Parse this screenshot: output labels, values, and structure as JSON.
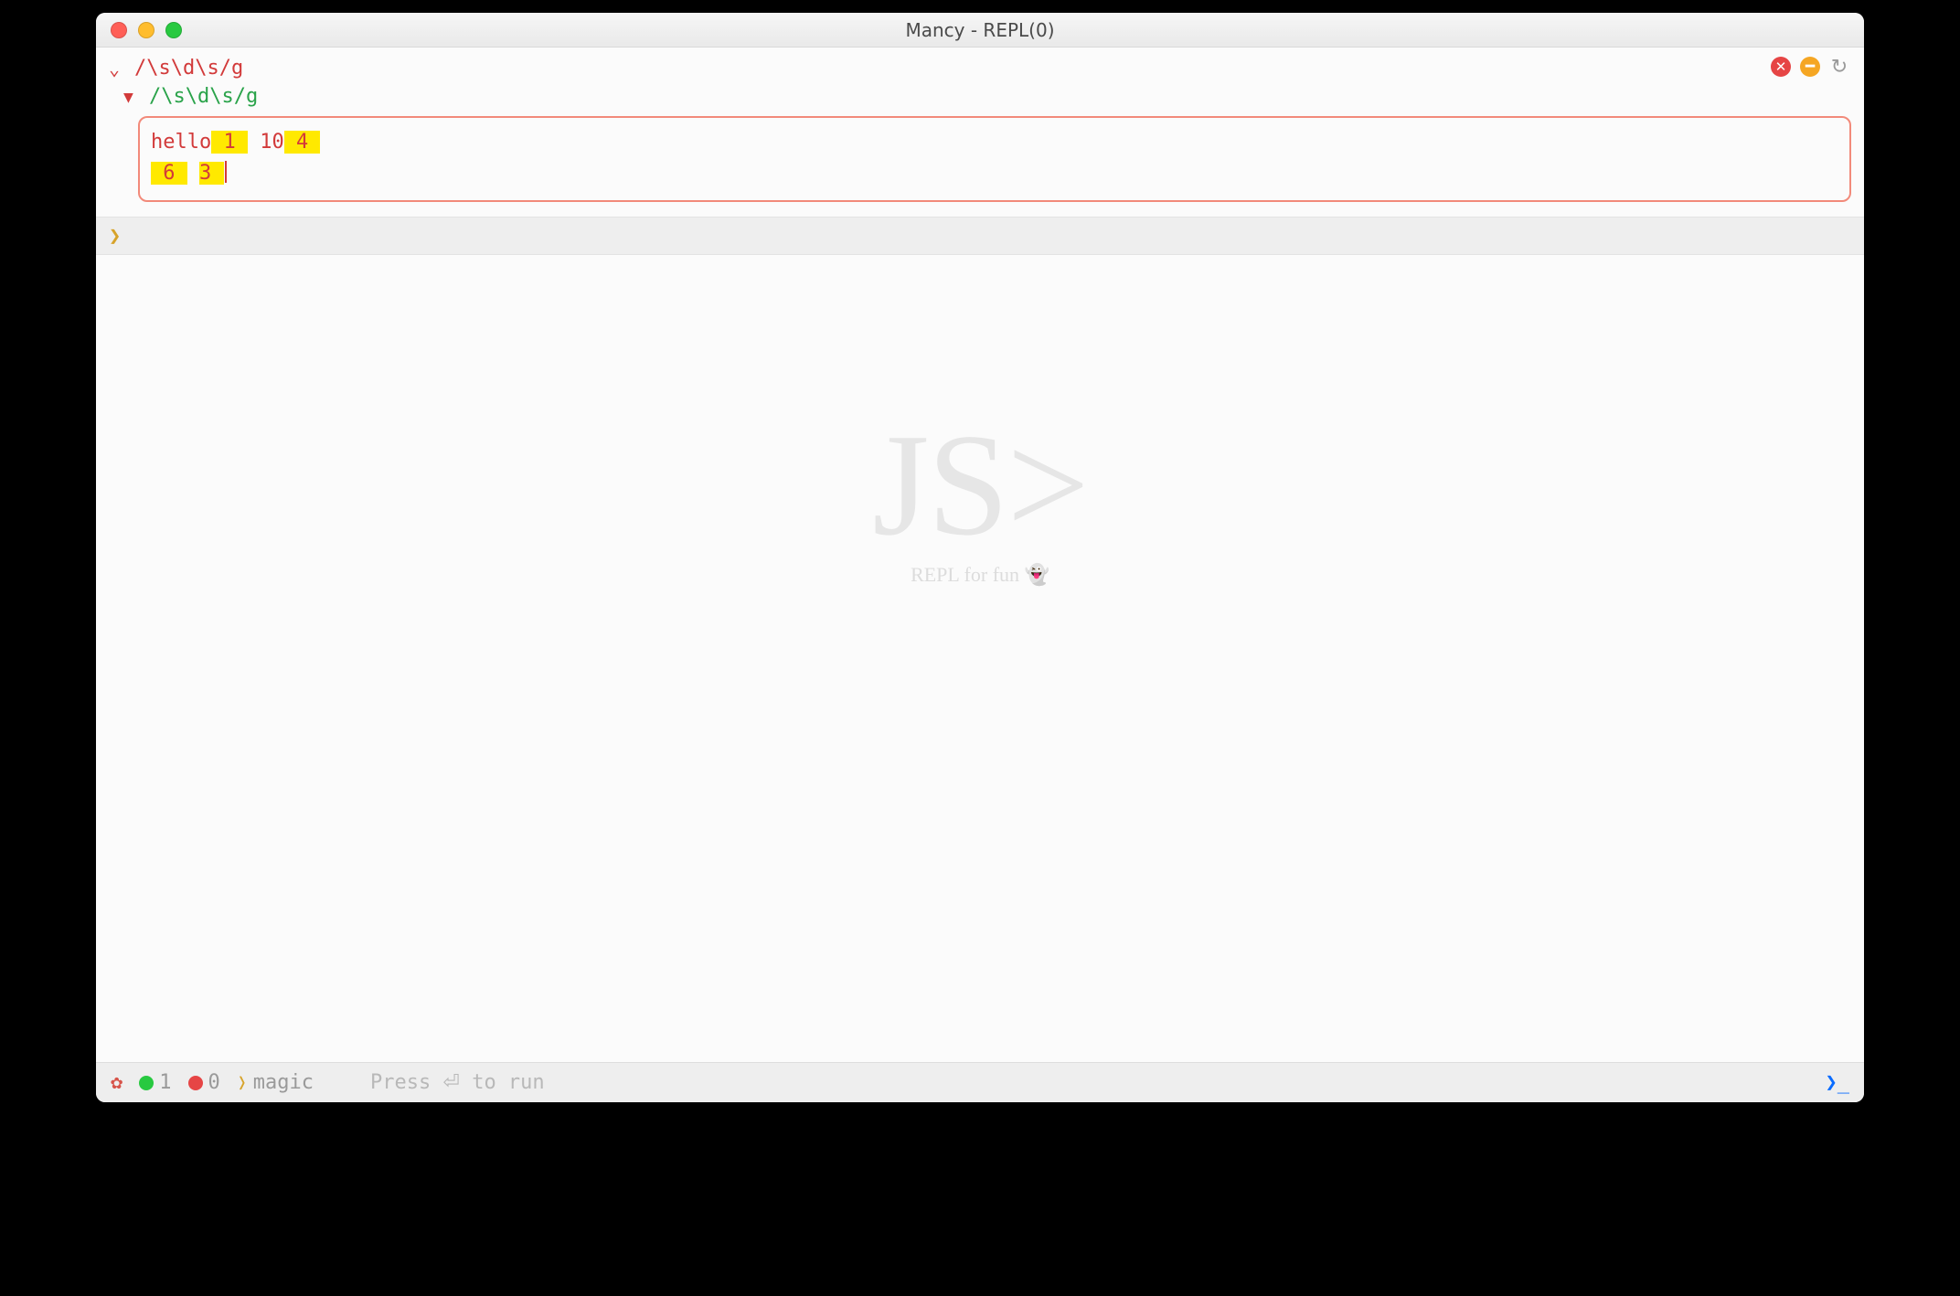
{
  "window": {
    "title": "Mancy - REPL(0)"
  },
  "topright": {
    "close_title": "Clear",
    "minus_title": "Collapse",
    "reload_title": "Rerun"
  },
  "input": {
    "chevron": "⌄",
    "regex": "/\\s\\d\\s/g"
  },
  "output": {
    "triangle": "▼",
    "regex": "/\\s\\d\\s/g",
    "result": {
      "line1": {
        "pre": "hello",
        "m1": " 1 ",
        "mid": " 10",
        "m2": " 4 "
      },
      "line2": {
        "m3": " 6 ",
        "gap": " ",
        "m4": "3 "
      }
    }
  },
  "prompt": {
    "symbol": "❯"
  },
  "watermark": {
    "logo": "JS>",
    "subtitle": "REPL for fun 👻"
  },
  "statusbar": {
    "gear": "✿",
    "success_count": "1",
    "error_count": "0",
    "tag_icon": "❭",
    "mode": "magic",
    "hint_pre": "Press ",
    "hint_sym": "⏎",
    "hint_post": " to run",
    "right_prompt": "❯_"
  }
}
